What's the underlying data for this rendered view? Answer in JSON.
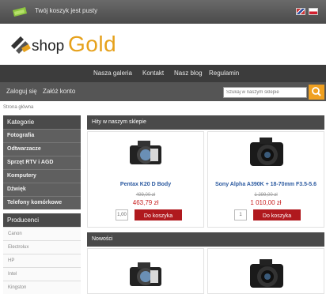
{
  "header": {
    "cart_text": "Twój koszyk jest pusty",
    "logo_shop": "shop",
    "logo_gold": "Gold",
    "colors": {
      "gold": "#e6a11b",
      "dark_bar": "#3c3c3c",
      "accent_red": "#b0191e",
      "search_orange": "#f0a020"
    },
    "languages": [
      "English flag",
      "Polish flag"
    ]
  },
  "nav": {
    "items": [
      "Nasza galeria",
      "Kontakt",
      "Nasz blog",
      "Regulamin"
    ]
  },
  "account": {
    "login": "Zaloguj się",
    "register": "Załóż konto",
    "search_placeholder": "Szukaj w naszym sklepie"
  },
  "breadcrumb": "Strona główna",
  "sidebar": {
    "categories_title": "Kategorie",
    "categories": [
      "Fotografia",
      "Odtwarzacze",
      "Sprzęt RTV i AGD",
      "Komputery",
      "Dźwięk",
      "Telefony komórkowe"
    ],
    "producers_title": "Producenci",
    "producers": [
      "Canon",
      "Electrolux",
      "HP",
      "Intel",
      "Kingston"
    ]
  },
  "main": {
    "hits_title": "Hity w naszym sklepie",
    "new_title": "Nowości",
    "products": [
      {
        "name": "Pentax K20 D Body",
        "old_price": "499,00 zł",
        "price": "463,79 zł",
        "qty": "1,00",
        "cart_label": "Do koszyka"
      },
      {
        "name": "Sony Alpha A390K + 18-70mm F3.5-5.6",
        "old_price": "1 299,00 zł",
        "price": "1 010,00 zł",
        "qty": "1",
        "cart_label": "Do koszyka"
      }
    ]
  }
}
